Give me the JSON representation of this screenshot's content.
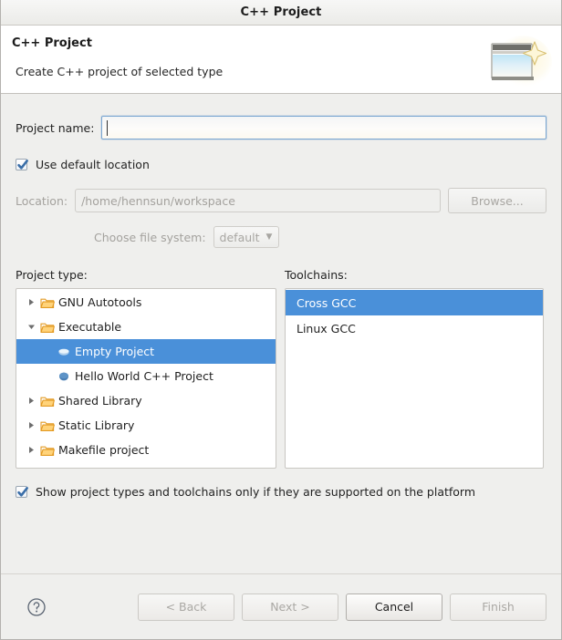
{
  "window": {
    "title": "C++ Project"
  },
  "header": {
    "title": "C++ Project",
    "description": "Create C++ project of selected type",
    "icon": "new-cpp-project-wizard-icon"
  },
  "form": {
    "project_name_label": "Project name:",
    "project_name_value": "",
    "project_name_placeholder": "",
    "use_default_location_label": "Use default location",
    "use_default_location_checked": true,
    "location_label": "Location:",
    "location_value": "/home/hennsun/workspace",
    "browse_label": "Browse...",
    "file_system_label": "Choose file system:",
    "file_system_value": "default",
    "file_system_options": [
      "default"
    ]
  },
  "project_type": {
    "label": "Project type:",
    "items": [
      {
        "label": "GNU Autotools",
        "level": 0,
        "icon": "folder-icon",
        "expander": "collapsed",
        "selected": false
      },
      {
        "label": "Executable",
        "level": 0,
        "icon": "folder-icon",
        "expander": "expanded",
        "selected": false
      },
      {
        "label": "Empty Project",
        "level": 1,
        "icon": "project-template-icon",
        "expander": "none",
        "selected": true
      },
      {
        "label": "Hello World C++ Project",
        "level": 1,
        "icon": "project-template-icon",
        "expander": "none",
        "selected": false
      },
      {
        "label": "Shared Library",
        "level": 0,
        "icon": "folder-icon",
        "expander": "collapsed",
        "selected": false
      },
      {
        "label": "Static Library",
        "level": 0,
        "icon": "folder-icon",
        "expander": "collapsed",
        "selected": false
      },
      {
        "label": "Makefile project",
        "level": 0,
        "icon": "folder-icon",
        "expander": "collapsed",
        "selected": false
      }
    ]
  },
  "toolchains": {
    "label": "Toolchains:",
    "items": [
      {
        "label": "Cross GCC",
        "selected": true
      },
      {
        "label": "Linux GCC",
        "selected": false
      }
    ]
  },
  "options": {
    "show_supported_label": "Show project types and toolchains only if they are supported on the platform",
    "show_supported_checked": true
  },
  "footer": {
    "help_icon": "help-circle-icon",
    "buttons": [
      {
        "label": "< Back",
        "name": "back-button",
        "enabled": false
      },
      {
        "label": "Next >",
        "name": "next-button",
        "enabled": false
      },
      {
        "label": "Cancel",
        "name": "cancel-button",
        "enabled": true
      },
      {
        "label": "Finish",
        "name": "finish-button",
        "enabled": false
      }
    ]
  },
  "colors": {
    "selection_blue": "#4a90d9",
    "dialog_bg": "#efefed",
    "list_bg": "#ffffff",
    "folder_icon": "#f0a732",
    "focus_border": "#7aa6d1"
  }
}
